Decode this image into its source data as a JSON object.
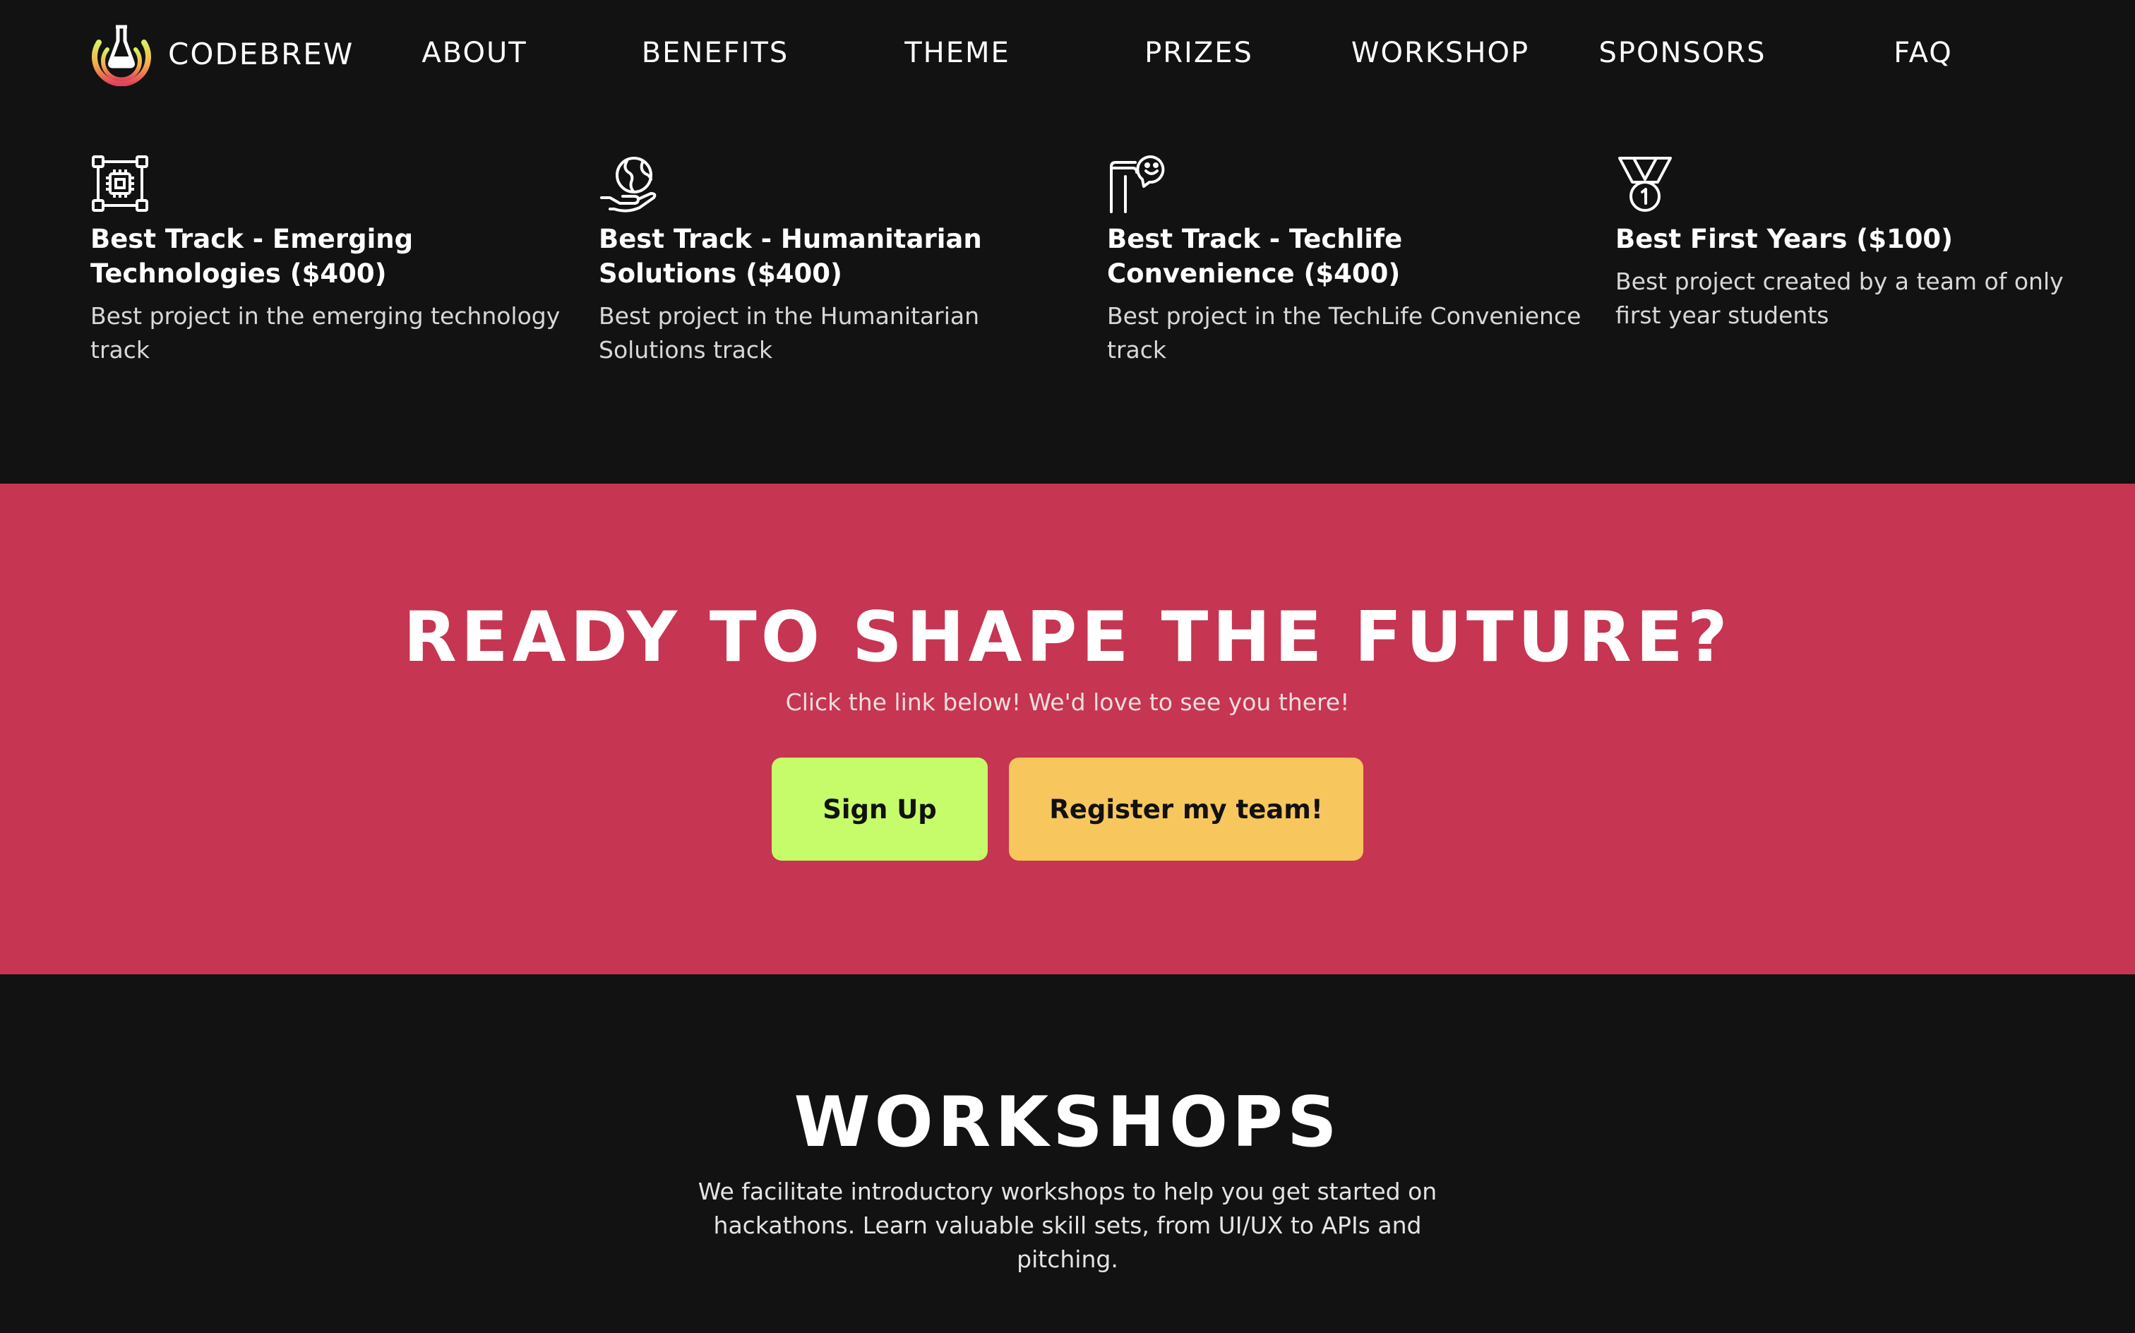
{
  "nav": {
    "brand": "CODEBREW",
    "links": [
      "ABOUT",
      "BENEFITS",
      "THEME",
      "PRIZES",
      "WORKSHOP",
      "SPONSORS",
      "FAQ"
    ]
  },
  "prizes": [
    {
      "icon": "chip-icon",
      "title": "Best Track - Emerging Technologies ($400)",
      "description": "Best project in the emerging technology track"
    },
    {
      "icon": "globe-hand-icon",
      "title": "Best Track - Humanitarian Solutions ($400)",
      "description": "Best project in the Humanitarian Solutions track"
    },
    {
      "icon": "flag-smiley-icon",
      "title": "Best Track - Techlife Convenience ($400)",
      "description": "Best project in the TechLife Convenience track"
    },
    {
      "icon": "medal-icon",
      "title": "Best First Years ($100)",
      "description": "Best project created by a team of only first year students"
    }
  ],
  "cta": {
    "title": "READY TO SHAPE THE FUTURE?",
    "subtitle": "Click the link below! We'd love to see you there!",
    "signup_label": "Sign Up",
    "register_label": "Register my team!"
  },
  "workshops": {
    "title": "WORKSHOPS",
    "description": "We facilitate introductory workshops to help you get started on hackathons. Learn valuable skill sets, from UI/UX to APIs and pitching."
  },
  "colors": {
    "background": "#121212",
    "cta_background": "#c63551",
    "signup_button": "#c6fb6a",
    "register_button": "#f7c65d"
  }
}
